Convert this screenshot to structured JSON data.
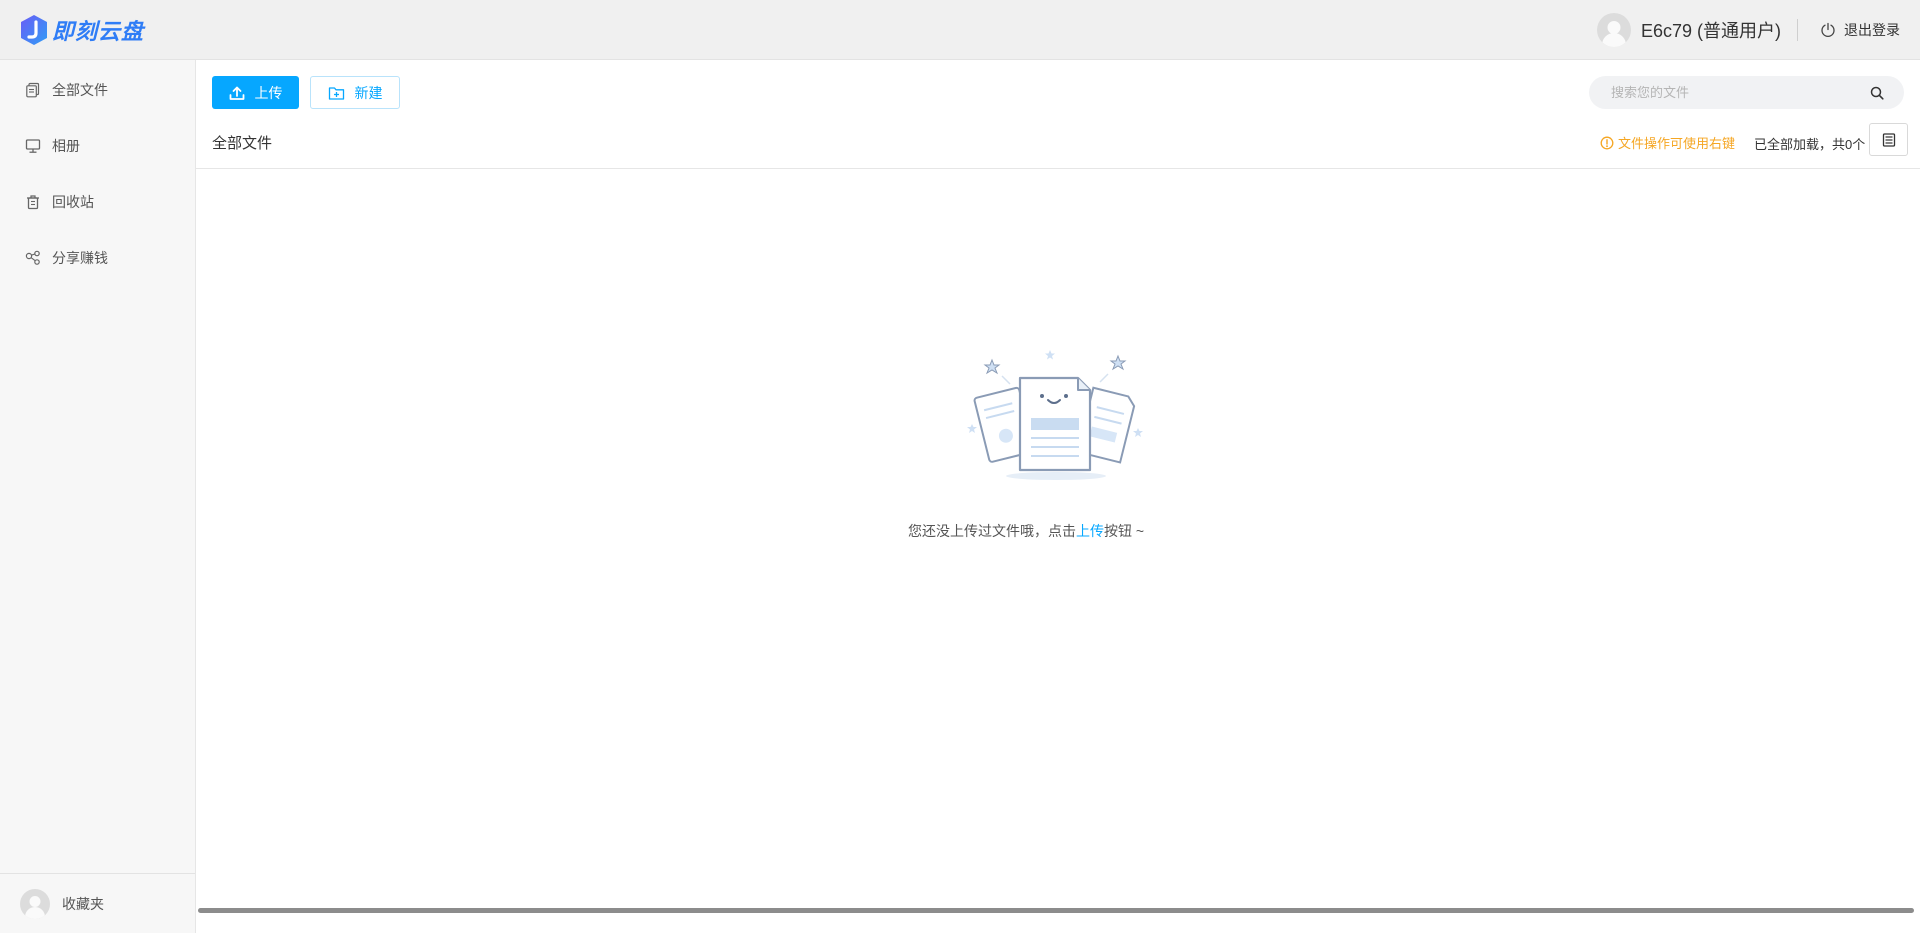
{
  "header": {
    "logo_text": "即刻云盘",
    "username": "E6c79 (普通用户)",
    "logout_label": "退出登录"
  },
  "sidebar": {
    "items": [
      {
        "label": "全部文件",
        "icon": "files-icon"
      },
      {
        "label": "相册",
        "icon": "monitor-icon"
      },
      {
        "label": "回收站",
        "icon": "trash-icon"
      },
      {
        "label": "分享赚钱",
        "icon": "share-icon"
      }
    ],
    "bottom_label": "收藏夹"
  },
  "toolbar": {
    "upload_label": "上传",
    "new_label": "新建",
    "search_placeholder": "搜索您的文件"
  },
  "content": {
    "breadcrumb": "全部文件",
    "tip": "文件操作可使用右键",
    "loaded_status": "已全部加载，共0个",
    "empty_before": "您还没上传过文件哦，点击",
    "empty_link": "上传",
    "empty_after": "按钮 ~"
  },
  "colors": {
    "accent": "#06a7ff",
    "tip": "#f5a623",
    "logo": "#2f7df6"
  }
}
